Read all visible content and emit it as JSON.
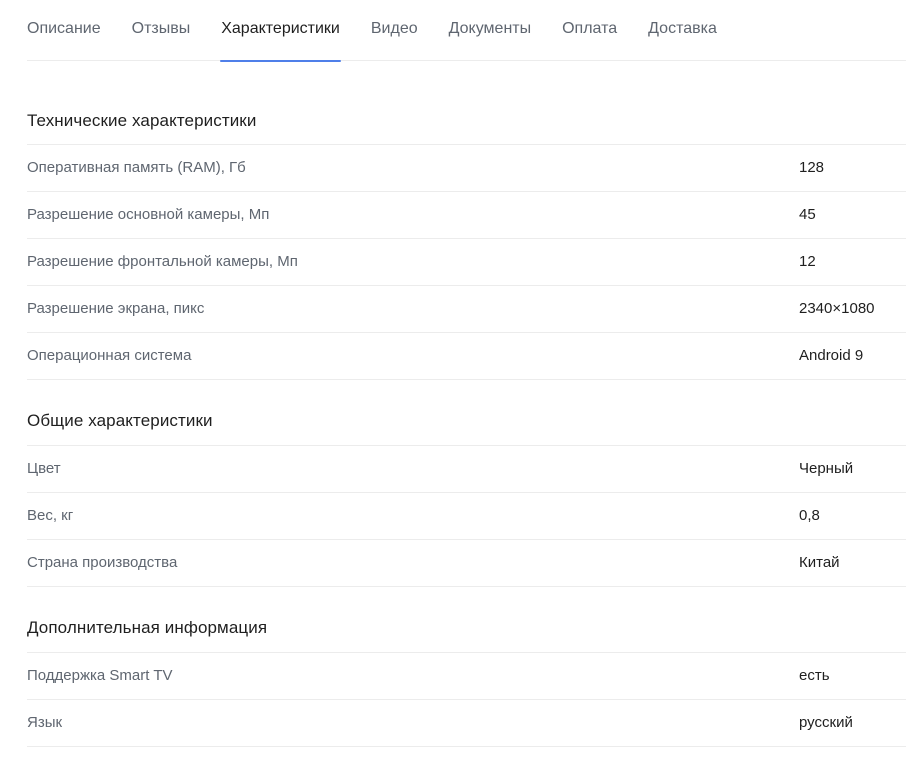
{
  "tabs": [
    {
      "label": "Описание",
      "active": false
    },
    {
      "label": "Отзывы",
      "active": false
    },
    {
      "label": "Характеристики",
      "active": true
    },
    {
      "label": "Видео",
      "active": false
    },
    {
      "label": "Документы",
      "active": false
    },
    {
      "label": "Оплата",
      "active": false
    },
    {
      "label": "Доставка",
      "active": false
    }
  ],
  "colors": {
    "active_tab_underline": "#4f7fe9",
    "divider": "#ececec",
    "label_text": "#5f6670",
    "value_text": "#1f1f1f"
  },
  "sections": [
    {
      "title": "Технические характеристики",
      "rows": [
        {
          "label": "Оперативная память (RAM), Гб",
          "value": "128"
        },
        {
          "label": "Разрешение основной камеры, Мп",
          "value": "45"
        },
        {
          "label": "Разрешение фронтальной камеры, Мп",
          "value": "12"
        },
        {
          "label": "Разрешение экрана, пикс",
          "value": "2340×1080"
        },
        {
          "label": "Операционная система",
          "value": "Android 9"
        }
      ]
    },
    {
      "title": "Общие характеристики",
      "rows": [
        {
          "label": "Цвет",
          "value": "Черный"
        },
        {
          "label": "Вес, кг",
          "value": "0,8"
        },
        {
          "label": "Страна производства",
          "value": "Китай"
        }
      ]
    },
    {
      "title": "Дополнительная информация",
      "rows": [
        {
          "label": "Поддержка Smart TV",
          "value": "есть"
        },
        {
          "label": "Язык",
          "value": "русский"
        }
      ]
    }
  ]
}
